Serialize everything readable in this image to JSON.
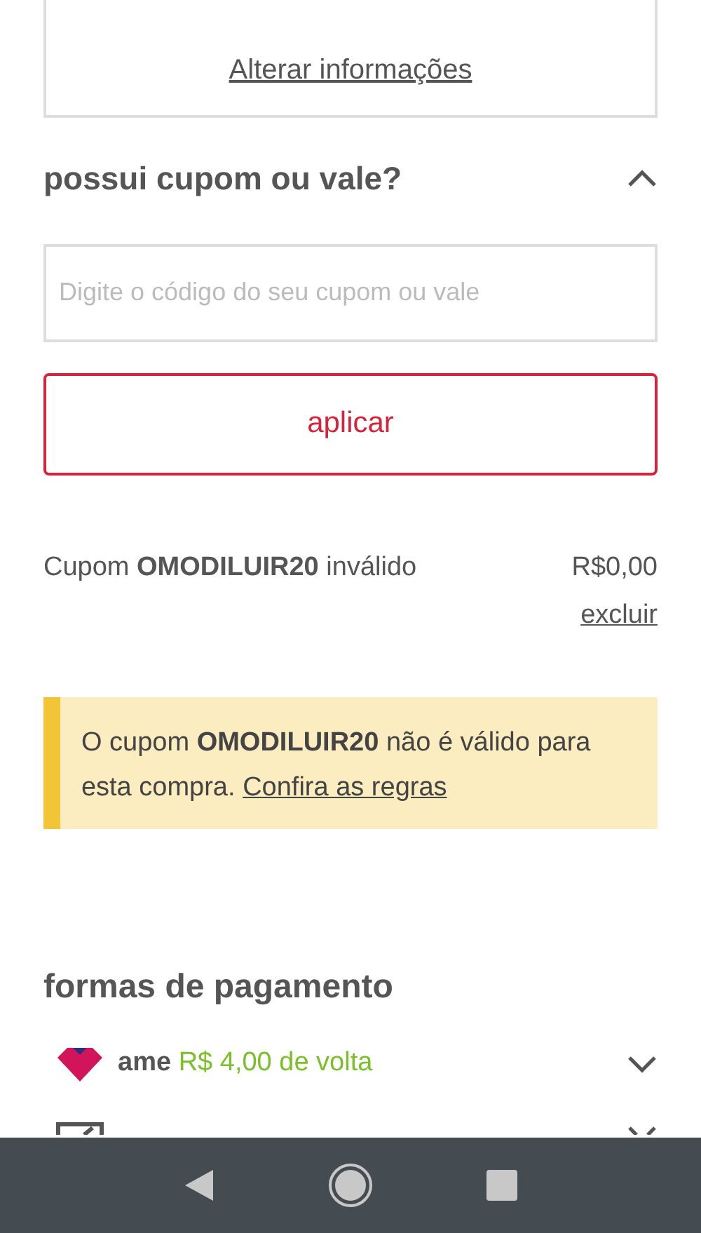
{
  "info_card": {
    "link": "Alterar informações"
  },
  "coupon_section": {
    "title": "possui cupom ou vale?",
    "expanded": true,
    "input": {
      "placeholder": "Digite o código do seu cupom ou vale"
    },
    "apply_button": "aplicar",
    "applied": {
      "text": "Cupom **OMODILUIR20** inválido",
      "amount": "R$0,00",
      "remove_link": "excluir"
    },
    "alert": {
      "text": "O cupom **OMODILUIR20** não é válido para esta compra.",
      "link": "Confira as regras"
    }
  },
  "payment": {
    "title": "formas de pagamento",
    "methods": [
      {
        "kind": "ame",
        "name": "ame",
        "cashback": "R$ 4,00 de volta",
        "expanded": false
      },
      {
        "kind": "card",
        "expanded": false
      }
    ]
  }
}
